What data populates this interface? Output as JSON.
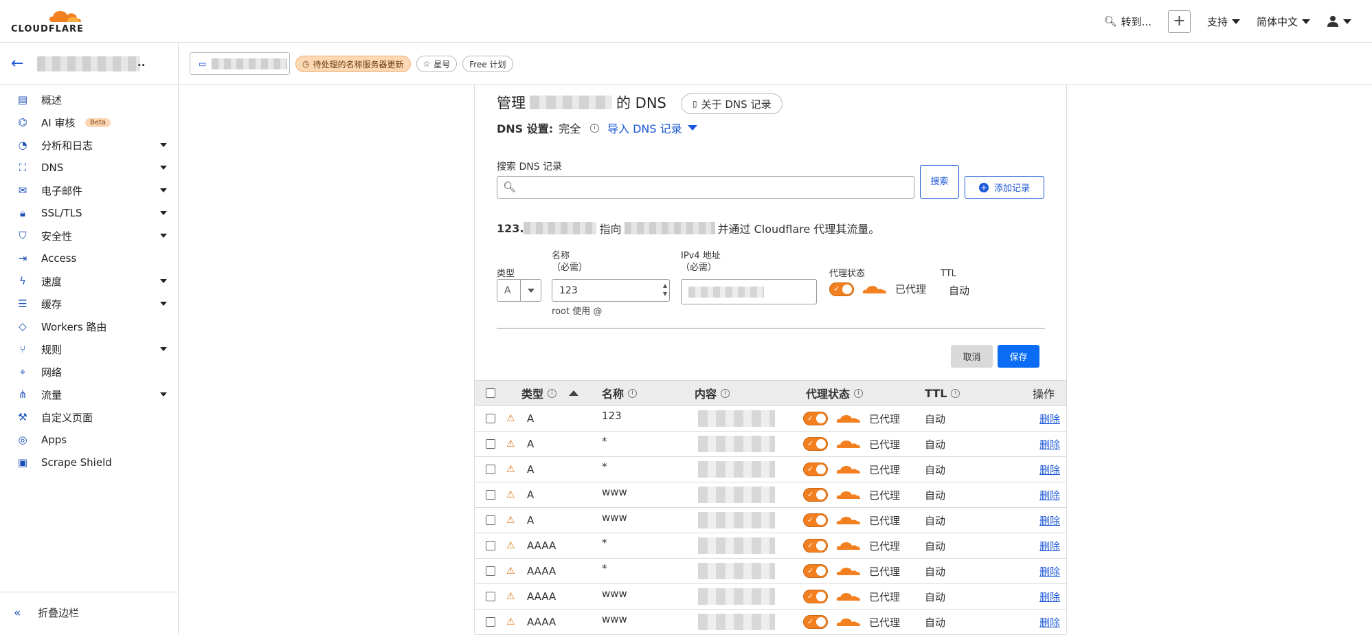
{
  "topbar": {
    "logo_text": "CLOUDFLARE",
    "goto_label": "转到...",
    "support_label": "支持",
    "language_label": "简体中文"
  },
  "subbar": {
    "pending_badge": "待处理的名称服务器更新",
    "star_badge": "星号",
    "plan_badge": "Free 计划"
  },
  "sidebar": {
    "items": [
      {
        "label": "概述",
        "icon": "document-icon",
        "has_caret": false
      },
      {
        "label": "AI 审核",
        "icon": "ai-icon",
        "has_caret": false,
        "badge": "Beta"
      },
      {
        "label": "分析和日志",
        "icon": "chart-icon",
        "has_caret": true
      },
      {
        "label": "DNS",
        "icon": "network-icon",
        "has_caret": true
      },
      {
        "label": "电子邮件",
        "icon": "mail-icon",
        "has_caret": true
      },
      {
        "label": "SSL/TLS",
        "icon": "lock-icon",
        "has_caret": true
      },
      {
        "label": "安全性",
        "icon": "shield-icon",
        "has_caret": true
      },
      {
        "label": "Access",
        "icon": "login-icon",
        "has_caret": false
      },
      {
        "label": "速度",
        "icon": "bolt-icon",
        "has_caret": true
      },
      {
        "label": "缓存",
        "icon": "storage-icon",
        "has_caret": true
      },
      {
        "label": "Workers 路由",
        "icon": "diamond-icon",
        "has_caret": false
      },
      {
        "label": "规则",
        "icon": "fork-icon",
        "has_caret": true
      },
      {
        "label": "网络",
        "icon": "pin-icon",
        "has_caret": false
      },
      {
        "label": "流量",
        "icon": "share-icon",
        "has_caret": true
      },
      {
        "label": "自定义页面",
        "icon": "wrench-icon",
        "has_caret": false
      },
      {
        "label": "Apps",
        "icon": "apps-icon",
        "has_caret": false
      },
      {
        "label": "Scrape Shield",
        "icon": "file-shield-icon",
        "has_caret": false
      }
    ],
    "collapse_label": "折叠边栏"
  },
  "main": {
    "title_prefix": "管理",
    "title_suffix": "的 DNS",
    "about_button": "关于 DNS 记录",
    "dns_setting_label": "DNS 设置:",
    "dns_setting_value": "完全",
    "import_link": "导入 DNS 记录",
    "search_label": "搜索 DNS 记录",
    "search_placeholder": "",
    "search_button": "搜索",
    "add_button": "添加记录",
    "points_prefix": "123.",
    "points_mid": "指向",
    "points_suffix": "并通过 Cloudflare 代理其流量。",
    "form": {
      "type_label": "类型",
      "type_value": "A",
      "name_label": "名称",
      "name_required": "（必需）",
      "name_value": "123",
      "root_hint": "root 使用 @",
      "ipv4_label": "IPv4 地址",
      "ipv4_required": "（必需）",
      "proxy_label": "代理状态",
      "proxy_value": "已代理",
      "ttl_label": "TTL",
      "ttl_value": "自动",
      "cancel": "取消",
      "save": "保存"
    },
    "table": {
      "headers": {
        "type": "类型",
        "name": "名称",
        "content": "内容",
        "proxy": "代理状态",
        "ttl": "TTL",
        "actions": "操作"
      },
      "rows": [
        {
          "type": "A",
          "name": "123",
          "proxy": "已代理",
          "ttl": "自动",
          "action": "删除"
        },
        {
          "type": "A",
          "name": "*",
          "proxy": "已代理",
          "ttl": "自动",
          "action": "删除"
        },
        {
          "type": "A",
          "name": "*",
          "proxy": "已代理",
          "ttl": "自动",
          "action": "删除"
        },
        {
          "type": "A",
          "name": "www",
          "proxy": "已代理",
          "ttl": "自动",
          "action": "删除"
        },
        {
          "type": "A",
          "name": "www",
          "proxy": "已代理",
          "ttl": "自动",
          "action": "删除"
        },
        {
          "type": "AAAA",
          "name": "*",
          "proxy": "已代理",
          "ttl": "自动",
          "action": "删除"
        },
        {
          "type": "AAAA",
          "name": "*",
          "proxy": "已代理",
          "ttl": "自动",
          "action": "删除"
        },
        {
          "type": "AAAA",
          "name": "www",
          "proxy": "已代理",
          "ttl": "自动",
          "action": "删除"
        },
        {
          "type": "AAAA",
          "name": "www",
          "proxy": "已代理",
          "ttl": "自动",
          "action": "删除"
        }
      ]
    }
  },
  "colors": {
    "accent": "#1a57d8",
    "cloudflare_orange": "#f38020",
    "save_blue": "#0a6cf5"
  }
}
